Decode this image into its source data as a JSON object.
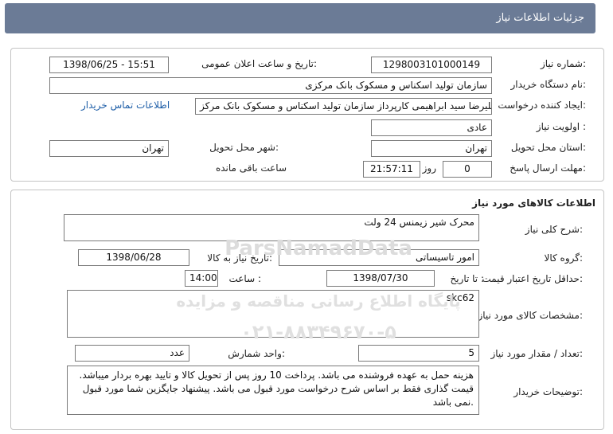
{
  "header": {
    "title": "جزئیات اطلاعات نیاز"
  },
  "need_info": {
    "need_number_label": "شماره نیاز:",
    "need_number": "1298003101000149",
    "announce_label": "تاریخ و ساعت اعلان عمومی:",
    "announce_value": "1398/06/25 - 15:51",
    "buyer_org_label": "نام دستگاه خریدار:",
    "buyer_org": "سازمان تولید اسکناس و مسکوک بانک مرکزی",
    "requester_label": "ایجاد کننده درخواست:",
    "requester": "سید علیرضا سید ابراهیمی کارپرداز سازمان تولید اسکناس و مسکوک بانک مرکز",
    "contact_link": "اطلاعات تماس خریدار",
    "priority_label": "اولویت نیاز :",
    "priority": "عادی",
    "province_label": "استان محل تحویل:",
    "province": "تهران",
    "city_label": "شهر محل تحویل:",
    "city": "تهران",
    "deadline_label": "مهلت ارسال پاسخ:",
    "days_value": "0",
    "days_label": "روز و",
    "time_value": "21:57:11",
    "remaining_label": "ساعت باقی مانده"
  },
  "goods": {
    "section_title": "اطلاعات کالاهای مورد نیاز",
    "summary_label": "شرح کلی نیاز:",
    "summary": "محرک شیر زیمنس 24 ولت",
    "group_label": "گروه کالا:",
    "group": "امور تاسیساتی",
    "need_date_label": "تاریخ نیاز به کالا:",
    "need_date": "1398/06/28",
    "validity_label": "حداقل تاریخ اعتبار قیمت:",
    "until_date_label": "تا تاریخ :",
    "until_date": "1398/07/30",
    "hour_label": "ساعت :",
    "hour": "14:00",
    "specs_label": "مشخصات کالای مورد نیاز:",
    "specs": "skc62",
    "qty_label": "تعداد / مقدار مورد نیاز:",
    "qty": "5",
    "unit_label": "واحد شمارش:",
    "unit": "عدد",
    "buyer_notes_label": "توضیحات خریدار:",
    "buyer_notes": "هزینه حمل به عهده فروشنده می باشد. پرداخت 10 روز پس از تحویل کالا و تایید بهره بردار میباشد. قیمت گذاری فقط بر اساس شرح درخواست مورد قبول می باشد. پیشنهاد جایگزین شما مورد قبول نمی باشد."
  },
  "watermark": {
    "line1": "ParsNamadData",
    "line2": "پایگاه اطلاع رسانی مناقصه و مزایده",
    "line3": "۰۲۱-۸۸۳۴۹۶۷۰-۵",
    "color": "#d9d9d9"
  }
}
